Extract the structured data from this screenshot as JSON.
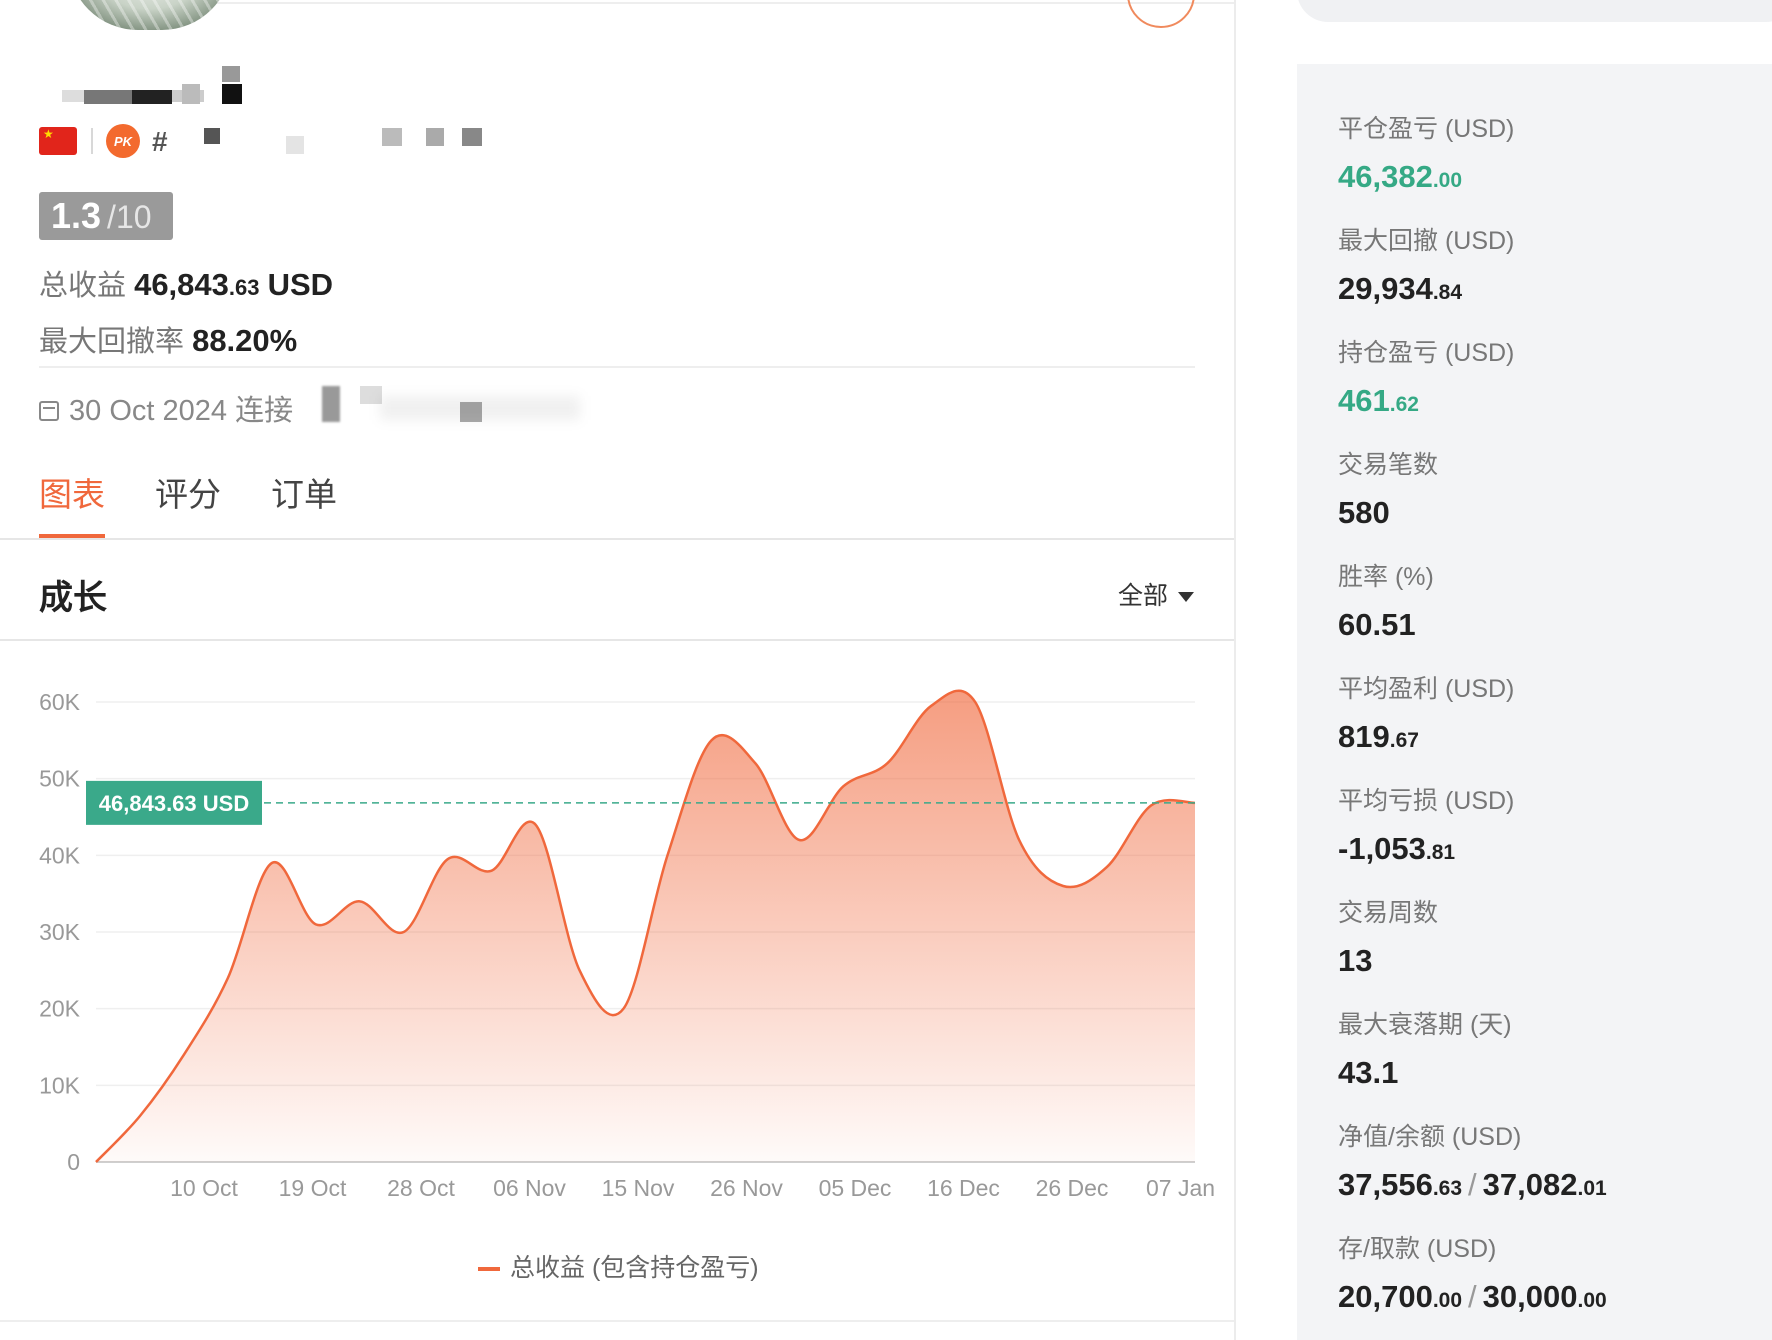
{
  "profile": {
    "rank_prefix": "#",
    "score_value": "1.3",
    "score_max": "/10",
    "total_profit_label": "总收益",
    "total_profit_int": "46,843",
    "total_profit_dec": ".63",
    "total_profit_unit": "USD",
    "max_drawdown_rate_label": "最大回撤率",
    "max_drawdown_rate": "88.20%",
    "connected_date": "30 Oct 2024",
    "connected_label": "连接",
    "flag_icon": "china-flag-icon",
    "pk_icon_text": "PK"
  },
  "tabs": [
    {
      "label": "图表",
      "active": true
    },
    {
      "label": "评分",
      "active": false
    },
    {
      "label": "订单",
      "active": false
    }
  ],
  "growth": {
    "title": "成长",
    "range_selected": "全部",
    "current_value_label": "46,843.63 USD",
    "legend_label": "总收益 (包含持仓盈亏)",
    "colors": {
      "line": "#f0683c",
      "marker": "#3aa98a"
    }
  },
  "chart_data": {
    "type": "area",
    "xlabel": "",
    "ylabel": "",
    "ylim": [
      0,
      60000
    ],
    "y_ticks": [
      "0",
      "10K",
      "20K",
      "30K",
      "40K",
      "50K",
      "60K"
    ],
    "x_ticks": [
      "10 Oct",
      "19 Oct",
      "28 Oct",
      "06 Nov",
      "15 Nov",
      "26 Nov",
      "05 Dec",
      "16 Dec",
      "26 Dec",
      "07 Jan"
    ],
    "grid": true,
    "reference_line": 46843.63,
    "series": [
      {
        "name": "总收益 (包含持仓盈亏)",
        "x": [
          0.0,
          0.4,
          0.8,
          1.2,
          1.6,
          2.0,
          2.4,
          2.8,
          3.2,
          3.6,
          4.0,
          4.4,
          4.8,
          5.2,
          5.6,
          6.0,
          6.4,
          6.8,
          7.2,
          7.6,
          8.0,
          8.4,
          8.8,
          9.2,
          9.6,
          10.0
        ],
        "values": [
          0,
          6000,
          14000,
          24000,
          39000,
          31000,
          34000,
          30000,
          39500,
          38000,
          44000,
          25000,
          20000,
          40000,
          55000,
          52000,
          42000,
          49000,
          52000,
          59500,
          60000,
          42000,
          36000,
          38500,
          46500,
          46843.63
        ]
      }
    ]
  },
  "metrics": [
    {
      "label": "平仓盈亏 (USD)",
      "int": "46,382",
      "dec": ".00",
      "color": "green"
    },
    {
      "label": "最大回撤 (USD)",
      "int": "29,934",
      "dec": ".84",
      "color": "default"
    },
    {
      "label": "持仓盈亏 (USD)",
      "int": "461",
      "dec": ".62",
      "color": "green"
    },
    {
      "label": "交易笔数",
      "int": "580",
      "dec": "",
      "color": "default"
    },
    {
      "label": "胜率 (%)",
      "int": "60.51",
      "dec": "",
      "color": "default"
    },
    {
      "label": "平均盈利 (USD)",
      "int": "819",
      "dec": ".67",
      "color": "default"
    },
    {
      "label": "平均亏损 (USD)",
      "int": "-1,053",
      "dec": ".81",
      "color": "default"
    },
    {
      "label": "交易周数",
      "int": "13",
      "dec": "",
      "color": "default"
    },
    {
      "label": "最大衰落期 (天)",
      "int": "43.1",
      "dec": "",
      "color": "default"
    },
    {
      "label": "净值/余额 (USD)",
      "int": "37,556",
      "dec": ".63",
      "int2": "37,082",
      "dec2": ".01",
      "color": "default"
    },
    {
      "label": "存/取款 (USD)",
      "int": "20,700",
      "dec": ".00",
      "int2": "30,000",
      "dec2": ".00",
      "color": "default"
    }
  ]
}
